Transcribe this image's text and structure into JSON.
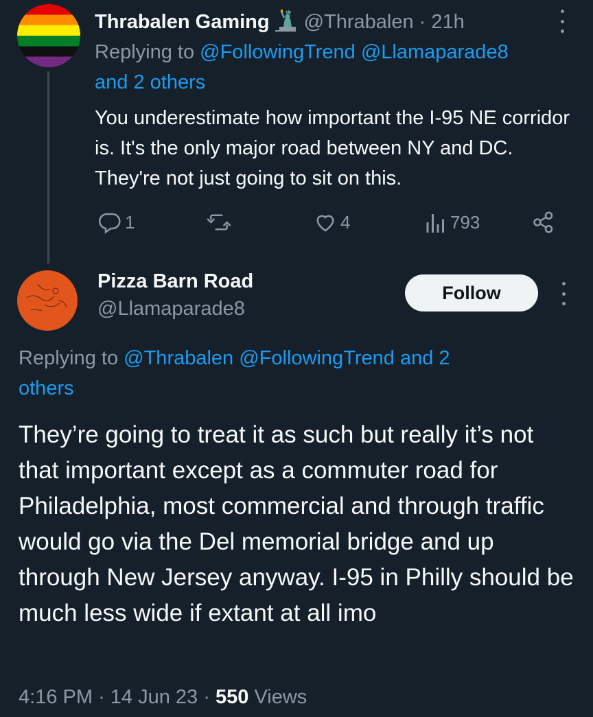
{
  "parent_tweet": {
    "display_name": "Thrabalen Gaming",
    "handle": "@Thrabalen",
    "separator": "·",
    "time": "21h",
    "replying_prefix": "Replying to",
    "replying_mention_1": "@FollowingTrend",
    "replying_mention_2": "@Llamaparade8",
    "replying_others": "and 2 others",
    "body": "You underestimate how important the I-95 NE corridor is. It's the only major road between NY and DC. They're not just going to sit on this.",
    "replies_count": "1",
    "likes_count": "4",
    "views_count": "793",
    "avatar_icon": "pride-flag-avatar",
    "badge_icon": "statue-of-liberty-icon"
  },
  "main_tweet": {
    "display_name": "Pizza Barn Road",
    "handle": "@Llamaparade8",
    "follow_label": "Follow",
    "replying_prefix": "Replying to",
    "replying_mention_1": "@Thrabalen",
    "replying_mention_2": "@FollowingTrend",
    "replying_and": "and 2",
    "replying_others": "others",
    "body": "They’re going to treat it as such but really it’s not that important except as a commuter road for Philadelphia, most commercial and through traffic would go via the Del memorial bridge and up through New Jersey anyway. I-95 in Philly should be much less wide if extant at all imo",
    "time": "4:16 PM",
    "date": "14 Jun 23",
    "separator": "·",
    "views_count": "550",
    "views_label": "Views",
    "avatar_icon": "orange-drawing-avatar"
  },
  "colors": {
    "background": "#15202b",
    "text_primary": "#f7f9f9",
    "text_secondary": "#8b98a5",
    "link": "#1d9bf0",
    "follow_button_bg": "#eff3f4"
  }
}
